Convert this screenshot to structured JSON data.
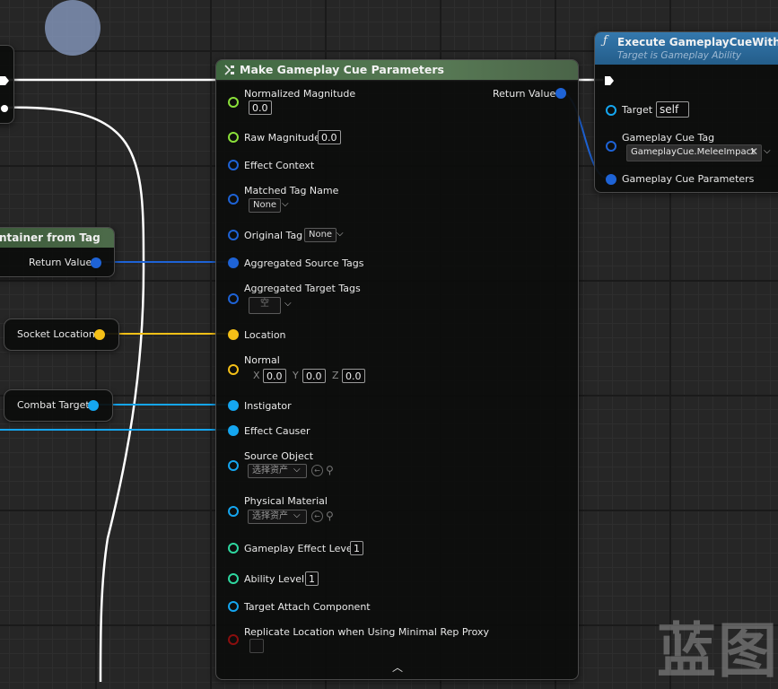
{
  "make_node": {
    "title": "Make Gameplay Cue Parameters",
    "return_label": "Return Value",
    "rows": [
      {
        "label": "Normalized Magnitude",
        "value": "0.0"
      },
      {
        "label": "Raw Magnitude",
        "value": "0.0"
      },
      {
        "label": "Effect Context"
      },
      {
        "label": "Matched Tag Name",
        "value": "None"
      },
      {
        "label": "Original Tag",
        "value": "None"
      },
      {
        "label": "Aggregated Source Tags"
      },
      {
        "label": "Aggregated Target Tags",
        "value": "空"
      },
      {
        "label": "Location"
      },
      {
        "label": "Normal",
        "x": "0.0",
        "y": "0.0",
        "z": "0.0"
      },
      {
        "label": "Instigator"
      },
      {
        "label": "Effect Causer"
      },
      {
        "label": "Source Object",
        "value": "选择资产"
      },
      {
        "label": "Physical Material",
        "value": "选择资产"
      },
      {
        "label": "Gameplay Effect Level",
        "value": "1"
      },
      {
        "label": "Ability Level",
        "value": "1"
      },
      {
        "label": "Target Attach Component"
      },
      {
        "label": "Replicate Location when Using Minimal Rep Proxy"
      }
    ],
    "axis_x": "X",
    "axis_y": "Y",
    "axis_z": "Z"
  },
  "execute_node": {
    "title": "Execute GameplayCueWithPara",
    "subtitle": "Target is Gameplay Ability",
    "target_label": "Target",
    "target_value": "self",
    "tag_label": "Gameplay Cue Tag",
    "tag_value": "GameplayCue.MeleeImpact",
    "params_label": "Gameplay Cue Parameters"
  },
  "container_node": {
    "title": "ntainer from Tag",
    "return_label": "Return Value"
  },
  "socket_node": {
    "label": "Socket Location"
  },
  "combat_node": {
    "label": "Combat Target"
  },
  "watermark": "蓝图",
  "colors": {
    "float_green": "#8be13a",
    "struct_blue": "#1e63d6",
    "object_blue": "#15a6f0",
    "vector_yellow": "#f5c017",
    "int_teal": "#2ed8a0",
    "bool_red": "#8b0e0e",
    "make_header": "#476a46",
    "exec_header": "#2d6fa0"
  }
}
